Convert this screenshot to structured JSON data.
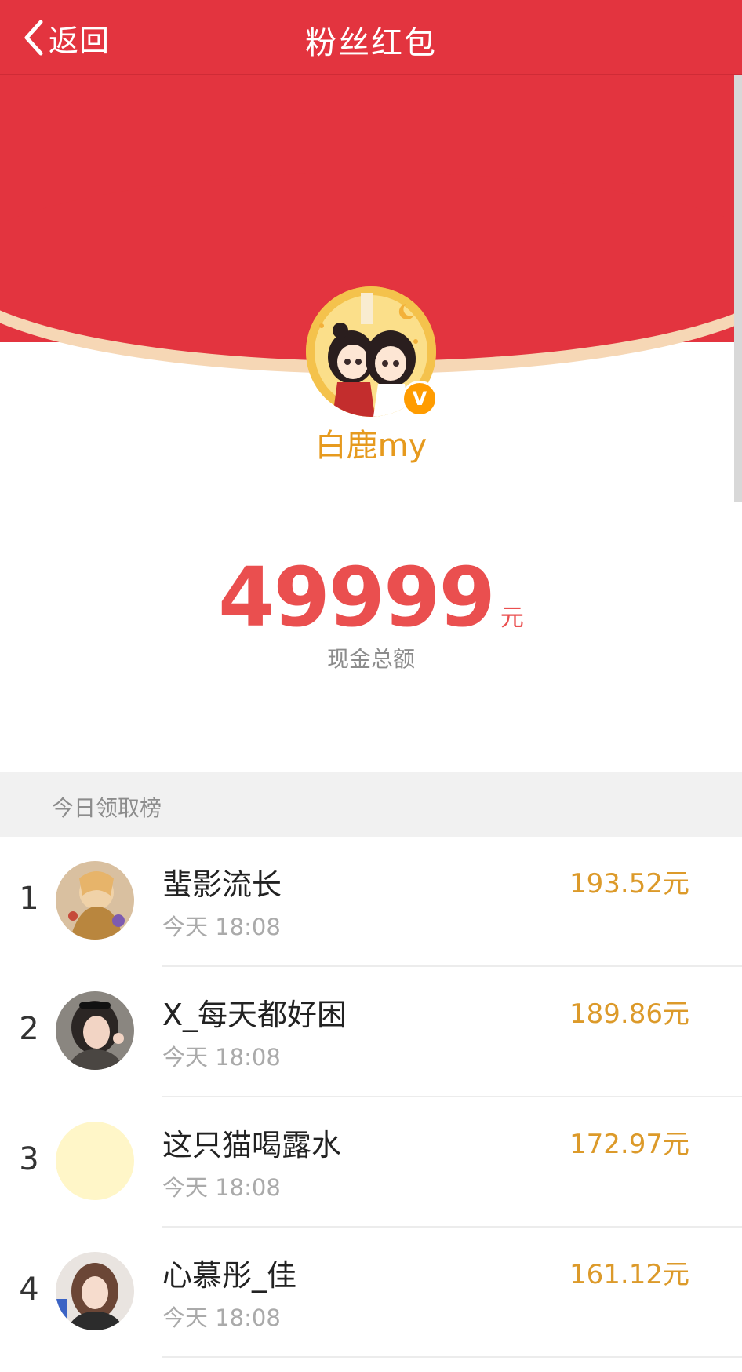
{
  "navbar": {
    "back_label": "返回",
    "title": "粉丝红包",
    "background": "#e3343f"
  },
  "profile": {
    "name": "白鹿my",
    "verified_badge": "V",
    "avatar_icon": "illustrated-couple-avatar"
  },
  "summary": {
    "amount": "49999",
    "unit": "元",
    "label": "现金总额"
  },
  "leaderboard": {
    "title": "今日领取榜",
    "items": [
      {
        "rank": "1",
        "name": "蜚影流长",
        "time": "今天 18:08",
        "amount": "193.52元"
      },
      {
        "rank": "2",
        "name": "X_每天都好困",
        "time": "今天 18:08",
        "amount": "189.86元"
      },
      {
        "rank": "3",
        "name": "这只猫喝露水",
        "time": "今天 18:08",
        "amount": "172.97元"
      },
      {
        "rank": "4",
        "name": "心慕彤_佳",
        "time": "今天 18:08",
        "amount": "161.12元"
      }
    ]
  },
  "colors": {
    "primary_red": "#e3343f",
    "amount_red": "#ea4f4f",
    "gold": "#dc9a2a",
    "name_gold": "#e69a1e"
  }
}
